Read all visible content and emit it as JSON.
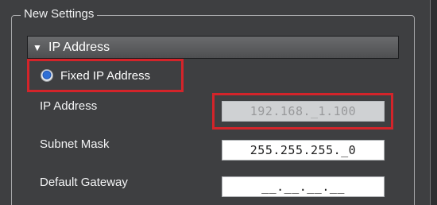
{
  "group": {
    "legend": "New Settings"
  },
  "section": {
    "caret_icon": "triangle-down",
    "title": "IP Address"
  },
  "radio": {
    "label": "Fixed IP Address",
    "selected": true,
    "accent": "#2f6fd6"
  },
  "fields": {
    "ip_address": {
      "label": "IP Address",
      "value": "192.168._1.100",
      "enabled": false
    },
    "subnet_mask": {
      "label": "Subnet Mask",
      "value": "255.255.255._0",
      "enabled": true
    },
    "default_gateway": {
      "label": "Default Gateway",
      "value": "__.__.__.__",
      "enabled": true
    }
  },
  "highlight_color": "#d3242a"
}
